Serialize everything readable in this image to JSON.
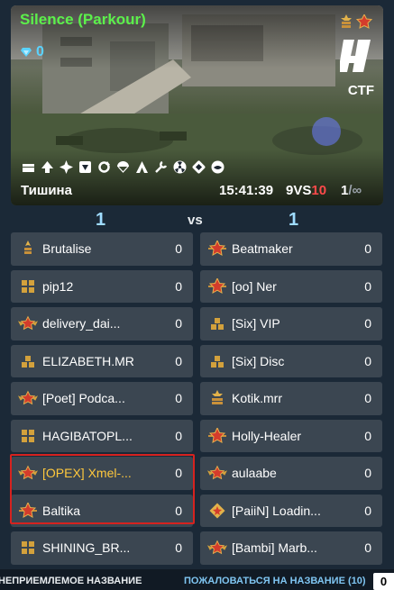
{
  "battle": {
    "map_name": "Silence (Parkour)",
    "crystals": "0",
    "mode": "CTF",
    "map_name_ru": "Тишина",
    "time": "15:41:39",
    "score_left": "9",
    "score_vs": "VS",
    "score_right": "10",
    "limit_current": "1",
    "limit_max": "/∞",
    "feature_icons": [
      "supplies-icon",
      "boost-icon",
      "upgrade-icon",
      "drone-icon",
      "respawn-icon",
      "parachute-icon",
      "alt-icon",
      "tools-icon",
      "nuclear-icon",
      "credit-icon",
      "rank-icon"
    ]
  },
  "teams": {
    "left_score": "1",
    "vs_label": "vs",
    "right_score": "1"
  },
  "left_team": [
    {
      "name": "Brutalise",
      "score": "0",
      "rank": "private-icon"
    },
    {
      "name": "pip12",
      "score": "0",
      "rank": "cross-icon"
    },
    {
      "name": "delivery_dai...",
      "score": "0",
      "rank": "winged-star-icon"
    },
    {
      "name": "ELIZABETH.MR",
      "score": "0",
      "rank": "squares-icon"
    },
    {
      "name": "[Poet] Podca...",
      "score": "0",
      "rank": "winged-star-icon"
    },
    {
      "name": "HAGIBATOPL...",
      "score": "0",
      "rank": "cross-icon"
    },
    {
      "name": "[OPEX] Xmel-...",
      "score": "0",
      "rank": "winged-star-icon"
    },
    {
      "name": "Baltika",
      "score": "0",
      "rank": "star-icon"
    },
    {
      "name": "SHINING_BR...",
      "score": "0",
      "rank": "cross-icon"
    }
  ],
  "right_team": [
    {
      "name": "Beatmaker",
      "score": "0",
      "rank": "star-icon"
    },
    {
      "name": "[oo] Ner",
      "score": "0",
      "rank": "star-icon"
    },
    {
      "name": "[Six] VIP",
      "score": "0",
      "rank": "squares-icon"
    },
    {
      "name": "[Six] Disc",
      "score": "0",
      "rank": "squares-icon"
    },
    {
      "name": "Kotik.mrr",
      "score": "0",
      "rank": "stripes-icon"
    },
    {
      "name": "Holly-Healer",
      "score": "0",
      "rank": "star-icon"
    },
    {
      "name": "aulaabe",
      "score": "0",
      "rank": "winged-star-icon"
    },
    {
      "name": "[PaiiN] Loadin...",
      "score": "0",
      "rank": "diamond-icon"
    },
    {
      "name": "[Bambi] Marb...",
      "score": "0",
      "rank": "winged-star-icon"
    }
  ],
  "footer": {
    "report_left": "НЕПРИЕМЛЕМОЕ НАЗВАНИЕ",
    "report_right": "ПОЖАЛОВАТЬСЯ НА НАЗВАНИЕ (10)",
    "box_label": "0"
  },
  "colors": {
    "map_name": "#5cf04b",
    "crystals": "#5ad3ff",
    "team_score": "#9fdcff",
    "highlight": "#d6221f",
    "self_name": "#ffc83d",
    "row_bg": "#3b4651"
  }
}
